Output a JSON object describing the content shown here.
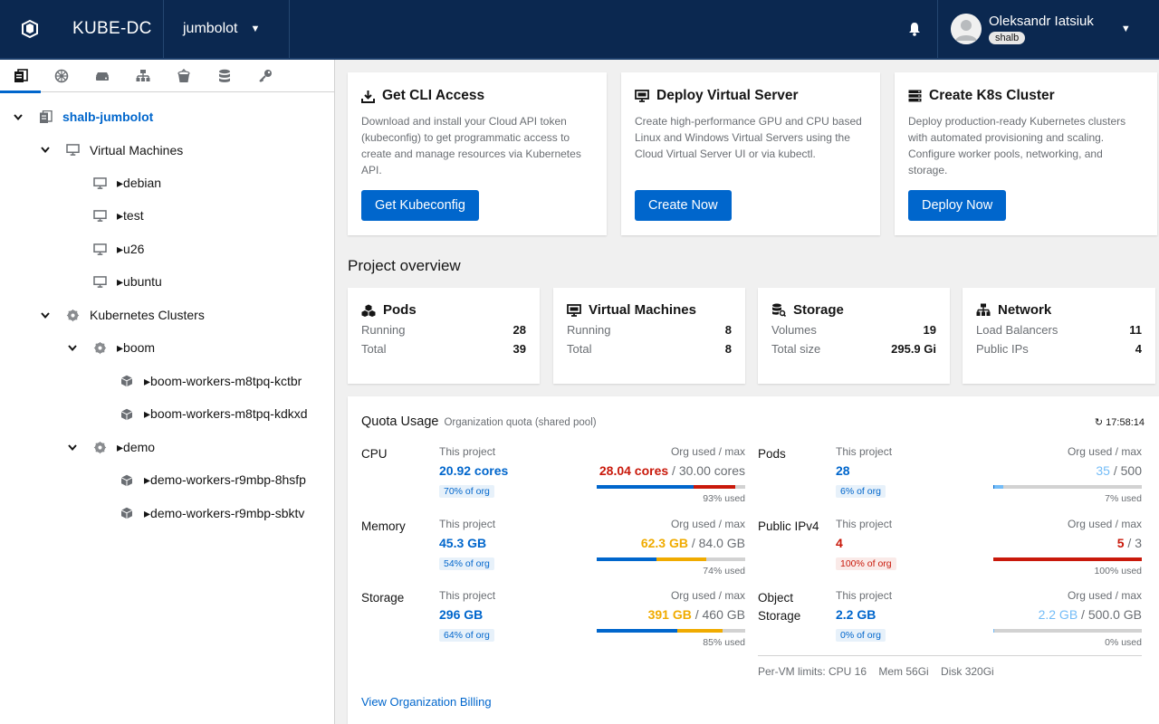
{
  "header": {
    "app_title": "KUBE-DC",
    "project": "jumbolot",
    "user_name": "Oleksandr Iatsiuk",
    "user_badge": "shalb"
  },
  "sidebar": {
    "tabs": [
      "projects-icon",
      "kubernetes-icon",
      "server-icon",
      "network-icon",
      "bucket-icon",
      "database-icon",
      "key-icon"
    ],
    "tree": [
      {
        "label": "shalb-jumbolot",
        "level": 0,
        "toggle": "expanded",
        "icon": "project-icon",
        "root": true
      },
      {
        "label": "Virtual Machines",
        "level": 1,
        "toggle": "expanded",
        "icon": "monitor-icon"
      },
      {
        "label": "▸debian",
        "level": 2,
        "toggle": "none",
        "icon": "monitor-icon"
      },
      {
        "label": "▸test",
        "level": 2,
        "toggle": "none",
        "icon": "monitor-icon"
      },
      {
        "label": "▸u26",
        "level": 2,
        "toggle": "none",
        "icon": "monitor-icon"
      },
      {
        "label": "▸ubuntu",
        "level": 2,
        "toggle": "none",
        "icon": "monitor-icon"
      },
      {
        "label": "Kubernetes Clusters",
        "level": 1,
        "toggle": "expanded",
        "icon": "helm-icon"
      },
      {
        "label": "▸boom",
        "level": 2,
        "toggle": "expanded",
        "icon": "helm-icon"
      },
      {
        "label": "▸boom-workers-m8tpq-kctbr",
        "level": 3,
        "toggle": "none",
        "icon": "cube-icon"
      },
      {
        "label": "▸boom-workers-m8tpq-kdkxd",
        "level": 3,
        "toggle": "none",
        "icon": "cube-icon"
      },
      {
        "label": "▸demo",
        "level": 2,
        "toggle": "expanded",
        "icon": "helm-icon"
      },
      {
        "label": "▸demo-workers-r9mbp-8hsfp",
        "level": 3,
        "toggle": "none",
        "icon": "cube-icon"
      },
      {
        "label": "▸demo-workers-r9mbp-sbktv",
        "level": 3,
        "toggle": "none",
        "icon": "cube-icon"
      }
    ]
  },
  "actions": [
    {
      "title": "Get CLI Access",
      "icon": "download-icon",
      "desc": "Download and install your Cloud API token (kubeconfig) to get programmatic access to create and manage resources via Kubernetes API.",
      "button": "Get Kubeconfig"
    },
    {
      "title": "Deploy Virtual Server",
      "icon": "monitor-icon",
      "desc": "Create high-performance GPU and CPU based Linux and Windows Virtual Servers using the Cloud Virtual Server UI or via kubectl.",
      "button": "Create Now"
    },
    {
      "title": "Create K8s Cluster",
      "icon": "server-stack-icon",
      "desc": "Deploy production-ready Kubernetes clusters with automated provisioning and scaling. Configure worker pools, networking, and storage.",
      "button": "Deploy Now"
    }
  ],
  "overview": {
    "title": "Project overview",
    "cards": [
      {
        "title": "Pods",
        "icon": "cubes-icon",
        "rows": [
          {
            "label": "Running",
            "value": "28"
          },
          {
            "label": "Total",
            "value": "39"
          }
        ]
      },
      {
        "title": "Virtual Machines",
        "icon": "monitor-icon",
        "rows": [
          {
            "label": "Running",
            "value": "8"
          },
          {
            "label": "Total",
            "value": "8"
          }
        ]
      },
      {
        "title": "Storage",
        "icon": "storage-icon",
        "rows": [
          {
            "label": "Volumes",
            "value": "19"
          },
          {
            "label": "Total size",
            "value": "295.9 Gi"
          }
        ]
      },
      {
        "title": "Network",
        "icon": "network-icon",
        "rows": [
          {
            "label": "Load Balancers",
            "value": "11"
          },
          {
            "label": "Public IPs",
            "value": "4"
          }
        ]
      }
    ]
  },
  "quota": {
    "title": "Quota Usage",
    "subtitle": "Organization quota (shared pool)",
    "time": "↻ 17:58:14",
    "this_label": "This project",
    "org_label": "Org used / max",
    "items": [
      {
        "name": "CPU",
        "this": "20.92 cores",
        "this_color": "blue",
        "badge": "70% of org",
        "badge_color": "blue",
        "org_used": "28.04 cores",
        "org_used_color": "red",
        "org_max": " / 30.00 cores",
        "pct": "93% used",
        "project_frac": 0.7,
        "org_frac": 0.93,
        "org_seg_color": "#c9190b"
      },
      {
        "name": "Pods",
        "this": "28",
        "this_color": "blue",
        "badge": "6% of org",
        "badge_color": "blue",
        "org_used": "35",
        "org_used_color": "light",
        "org_max": " / 500",
        "pct": "7% used",
        "project_frac": 0.056,
        "org_frac": 0.07,
        "org_seg_color": "#73bcf7"
      },
      {
        "name": "Memory",
        "this": "45.3 GB",
        "this_color": "blue",
        "badge": "54% of org",
        "badge_color": "blue",
        "org_used": "62.3 GB",
        "org_used_color": "orange",
        "org_max": " / 84.0 GB",
        "pct": "74% used",
        "project_frac": 0.54,
        "org_frac": 0.74,
        "org_seg_color": "#f0ab00"
      },
      {
        "name": "Public IPv4",
        "this": "4",
        "this_color": "red",
        "badge": "100% of org",
        "badge_color": "red",
        "org_used": "5",
        "org_used_color": "red",
        "org_max": " / 3",
        "pct": "100% used",
        "project_frac": 1.0,
        "org_frac": 1.0,
        "org_seg_color": "#c9190b",
        "full_red": true
      },
      {
        "name": "Storage",
        "this": "296 GB",
        "this_color": "blue",
        "badge": "64% of org",
        "badge_color": "blue",
        "org_used": "391 GB",
        "org_used_color": "orange",
        "org_max": " / 460 GB",
        "pct": "85% used",
        "project_frac": 0.64,
        "org_frac": 0.85,
        "org_seg_color": "#f0ab00"
      },
      {
        "name": "Object Storage",
        "this": "2.2 GB",
        "this_color": "blue",
        "badge": "0% of org",
        "badge_color": "blue",
        "org_used": "2.2 GB",
        "org_used_color": "light",
        "org_max": " / 500.0 GB",
        "pct": "0% used",
        "project_frac": 0.0,
        "org_frac": 0.004,
        "org_seg_color": "#73bcf7"
      }
    ],
    "limits": "Per-VM limits: CPU 16    Mem 56Gi    Disk 320Gi",
    "billing_link": "View Organization Billing"
  },
  "colors": {
    "accent": "#0066cc",
    "header_bg": "#0b2850",
    "danger": "#c9190b",
    "warning": "#f0ab00"
  }
}
